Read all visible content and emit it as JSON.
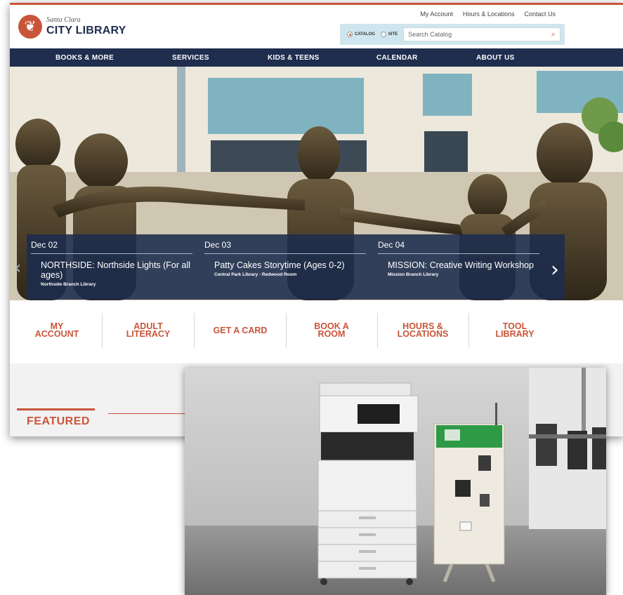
{
  "logo": {
    "subtitle": "Santa Clara",
    "title": "CITY LIBRARY"
  },
  "utility_links": [
    "My Account",
    "Hours & Locations",
    "Contact Us"
  ],
  "search": {
    "scope_catalog": "CATALOG",
    "scope_site": "SITE",
    "selected_scope": "CATALOG",
    "placeholder": "Search Catalog"
  },
  "nav": [
    "BOOKS & MORE",
    "SERVICES",
    "KIDS & TEENS",
    "CALENDAR",
    "ABOUT US"
  ],
  "events": [
    {
      "date": "Dec 02",
      "title": "NORTHSIDE: Northside Lights (For all ages)",
      "location": "Northside Branch Library"
    },
    {
      "date": "Dec 03",
      "title": "Patty Cakes Storytime (Ages 0-2)",
      "location": "Central Park Library - Redwood Room"
    },
    {
      "date": "Dec 04",
      "title": "MISSION: Creative Writing Workshop",
      "location": "Mission Branch Library"
    }
  ],
  "quick_links": [
    [
      "MY",
      "ACCOUNT"
    ],
    [
      "ADULT",
      "LITERACY"
    ],
    [
      "GET A CARD"
    ],
    [
      "BOOK A",
      "ROOM"
    ],
    [
      "HOURS &",
      "LOCATIONS"
    ],
    [
      "TOOL",
      "LIBRARY"
    ]
  ],
  "featured_heading": "FEATURED",
  "colors": {
    "accent": "#c8553a",
    "navy": "#1f2d4e",
    "search_bg": "#cfe6ee"
  }
}
